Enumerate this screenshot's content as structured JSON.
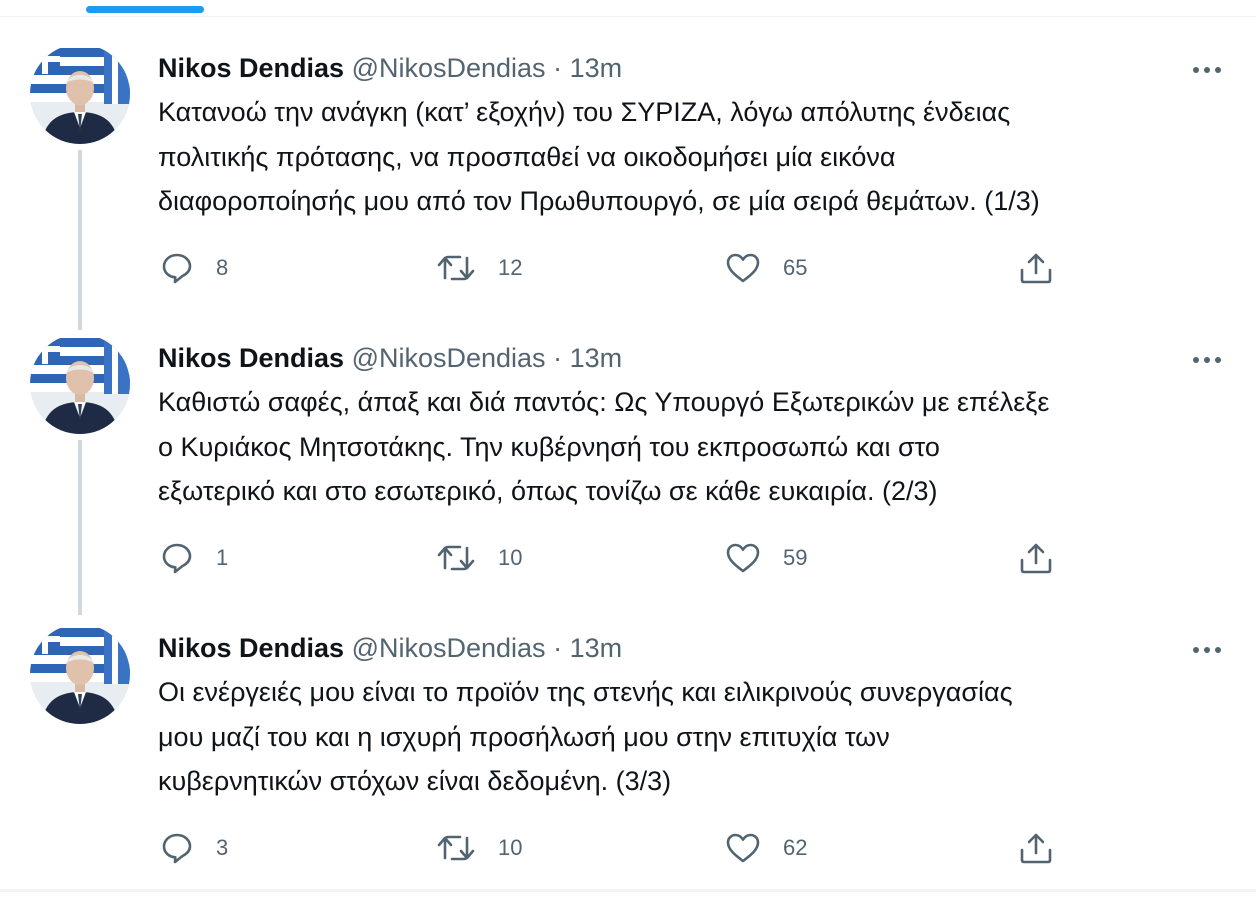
{
  "colors": {
    "accent": "#1d9bf0",
    "text_primary": "#0f1419",
    "text_secondary": "#536471",
    "thread_line": "#cfd9de"
  },
  "tweets": [
    {
      "author_name": "Nikos Dendias",
      "handle": "@NikosDendias",
      "separator": "·",
      "time": "13m",
      "text": "Κατανοώ την ανάγκη (κατ’ εξοχήν) του ΣΥΡΙΖΑ, λόγω απόλυτης ένδειας\nπολιτικής πρότασης, να προσπαθεί να οικοδομήσει μία εικόνα\nδιαφοροποίησής μου από τον Πρωθυπουργό, σε μία σειρά θεμάτων. (1/3)",
      "replies": "8",
      "retweets": "12",
      "likes": "65"
    },
    {
      "author_name": "Nikos Dendias",
      "handle": "@NikosDendias",
      "separator": "·",
      "time": "13m",
      "text": "Καθιστώ σαφές, άπαξ και διά παντός: Ως Υπουργό Εξωτερικών με επέλεξε\nο Κυριάκος Μητσοτάκης. Την κυβέρνησή του εκπροσωπώ και στο\nεξωτερικό και στο εσωτερικό, όπως τονίζω σε κάθε ευκαιρία. (2/3)",
      "replies": "1",
      "retweets": "10",
      "likes": "59"
    },
    {
      "author_name": "Nikos Dendias",
      "handle": "@NikosDendias",
      "separator": "·",
      "time": "13m",
      "text": "Οι ενέργειές μου είναι το προϊόν της στενής και ειλικρινούς συνεργασίας\nμου μαζί του και η ισχυρή προσήλωσή μου στην επιτυχία των\nκυβερνητικών στόχων είναι δεδομένη. (3/3)",
      "replies": "3",
      "retweets": "10",
      "likes": "62"
    }
  ],
  "icons": {
    "reply": "reply-icon",
    "retweet": "retweet-icon",
    "like": "like-icon",
    "share": "share-icon",
    "more": "more-icon"
  }
}
